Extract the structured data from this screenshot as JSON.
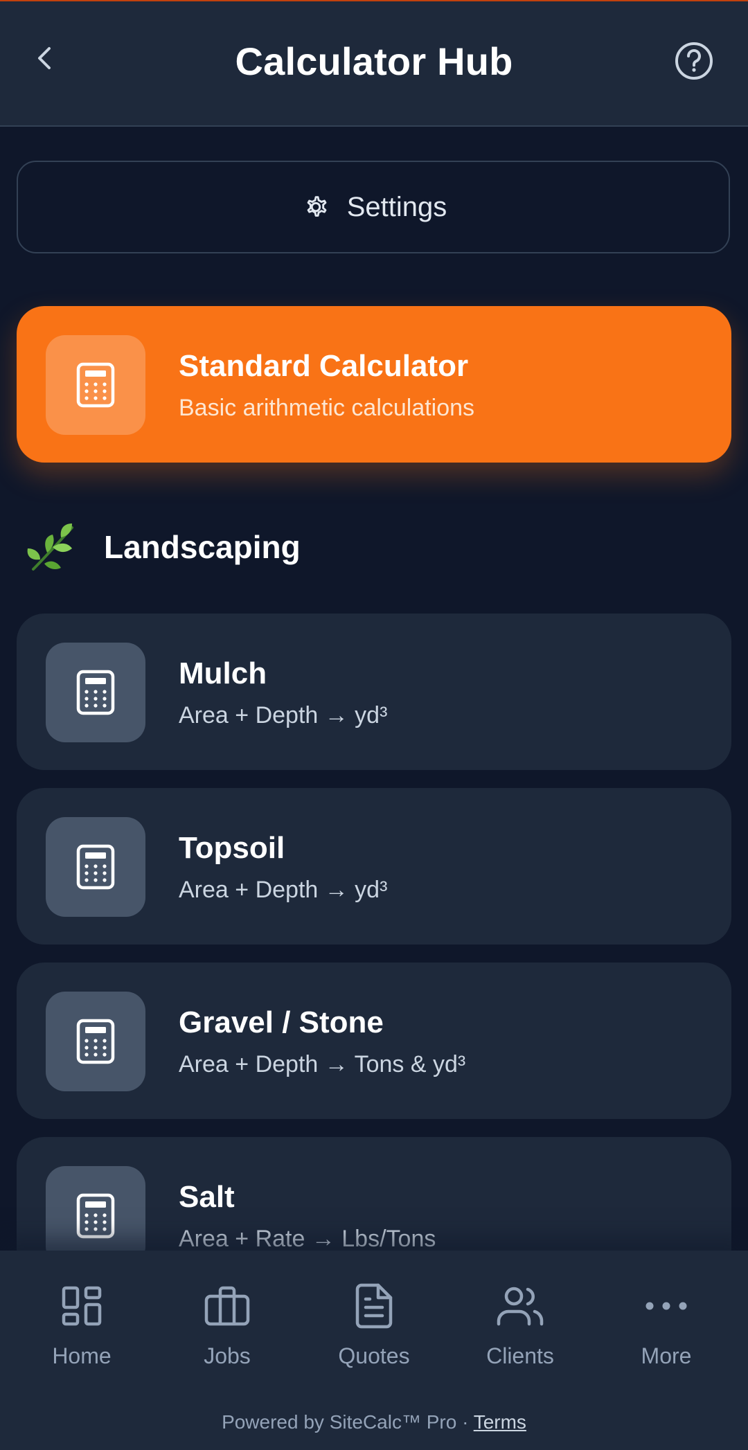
{
  "header": {
    "title": "Calculator Hub",
    "back_icon": "chevron-left-icon",
    "help_icon": "help-circle-icon"
  },
  "settings": {
    "label": "Settings",
    "icon": "gear-icon"
  },
  "featured": {
    "title": "Standard Calculator",
    "subtitle": "Basic arithmetic calculations",
    "icon": "calculator-icon",
    "color": "#f97316"
  },
  "section": {
    "title": "Landscaping",
    "icon": "leaf-icon"
  },
  "calculators": [
    {
      "title": "Mulch",
      "subtitle": "Area + Depth → yd³",
      "icon": "calculator-icon"
    },
    {
      "title": "Topsoil",
      "subtitle": "Area + Depth → yd³",
      "icon": "calculator-icon"
    },
    {
      "title": "Gravel / Stone",
      "subtitle": "Area + Depth → Tons & yd³",
      "icon": "calculator-icon"
    },
    {
      "title": "Salt",
      "subtitle": "Area + Rate → Lbs/Tons",
      "icon": "calculator-icon"
    }
  ],
  "nav": {
    "items": [
      {
        "label": "Home",
        "icon": "home-grid-icon"
      },
      {
        "label": "Jobs",
        "icon": "briefcase-icon"
      },
      {
        "label": "Quotes",
        "icon": "document-icon"
      },
      {
        "label": "Clients",
        "icon": "users-icon"
      },
      {
        "label": "More",
        "icon": "more-dots-icon"
      }
    ]
  },
  "footer": {
    "text": "Powered by SiteCalc™ Pro · ",
    "terms": "Terms"
  },
  "colors": {
    "background": "#0f172a",
    "surface": "#1e293b",
    "accent": "#f97316"
  }
}
